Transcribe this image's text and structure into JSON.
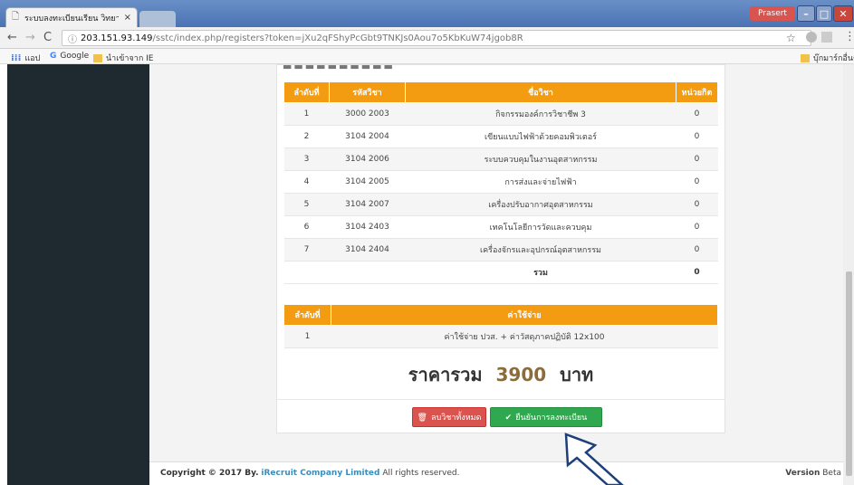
{
  "browser": {
    "tab_title": "ระบบลงทะเบียนเรียน วิทยาลั",
    "tab_close": "×",
    "user_badge": "Prasert",
    "url_host": "203.151.93.149",
    "url_path": "/sstc/index.php/registers?token=jXu2qFShyPcGbt9TNKJs0Aou7o5KbKuW74jgob8R",
    "bookmarks": [
      "แอป",
      "Google",
      "นำเข้าจาก IE"
    ],
    "bookmarks_other": "บุ๊กมาร์กอื่นๆ"
  },
  "subjects_table": {
    "headers": [
      "ลำดับที่",
      "รหัสวิชา",
      "ชื่อวิชา",
      "หน่วยกิต"
    ],
    "rows": [
      {
        "no": "1",
        "code": "3000 2003",
        "name": "กิจกรรมองค์การวิชาชีพ 3",
        "credit": "0"
      },
      {
        "no": "2",
        "code": "3104 2004",
        "name": "เขียนแบบไฟฟ้าด้วยคอมพิวเตอร์",
        "credit": "0"
      },
      {
        "no": "3",
        "code": "3104 2006",
        "name": "ระบบควบคุมในงานอุตสาหกรรม",
        "credit": "0"
      },
      {
        "no": "4",
        "code": "3104 2005",
        "name": "การส่งและจ่ายไฟฟ้า",
        "credit": "0"
      },
      {
        "no": "5",
        "code": "3104 2007",
        "name": "เครื่องปรับอากาศอุตสาหกรรม",
        "credit": "0"
      },
      {
        "no": "6",
        "code": "3104 2403",
        "name": "เทคโนโลยีการวัดและควบคุม",
        "credit": "0"
      },
      {
        "no": "7",
        "code": "3104 2404",
        "name": "เครื่องจักรและอุปกรณ์อุตสาหกรรม",
        "credit": "0"
      }
    ],
    "total_label": "รวม",
    "total_value": "0"
  },
  "fees_table": {
    "headers": [
      "ลำดับที่",
      "ค่าใช้จ่าย"
    ],
    "rows": [
      {
        "no": "1",
        "desc": "ค่าใช้จ่าย ปวส. + ค่าวัสดุภาคปฏิบัติ 12x100"
      }
    ]
  },
  "total": {
    "label": "ราคารวม",
    "amount": "3900",
    "currency": "บาท"
  },
  "buttons": {
    "clear": "ลบวิชาทั้งหมด",
    "confirm": "ยืนยันการลงทะเบียน"
  },
  "footer": {
    "copyright": "Copyright © 2017 By.",
    "company": "iRecruit Company Limited",
    "rights": "All rights reserved.",
    "version_label": "Version",
    "version_value": "Beta"
  },
  "colors": {
    "header_orange": "#f39c12",
    "sidebar": "#1f2a30",
    "danger": "#d9534f",
    "success": "#2fa84f",
    "amount": "#8a6d3b"
  }
}
